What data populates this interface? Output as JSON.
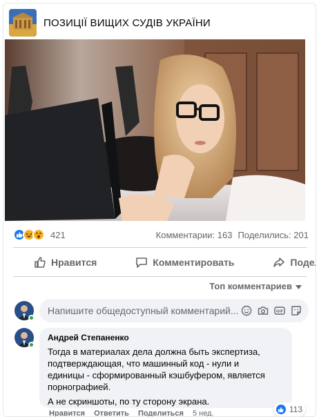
{
  "page": {
    "title": "ПОЗИЦІЇ ВИЩИХ СУДІВ УКРАЇНИ",
    "avatar_icon": "page-logo-icon"
  },
  "post": {
    "photo_icon": "post-photo"
  },
  "stats": {
    "reactions": [
      "like",
      "haha",
      "wow"
    ],
    "reaction_count": "421",
    "comments": "Комментарии: 163",
    "shares": "Поделились: 201"
  },
  "actions": {
    "like": "Нравится",
    "comment": "Комментировать",
    "share": "Поделиться"
  },
  "sort": {
    "label": "Топ комментариев"
  },
  "composer": {
    "placeholder": "Напишите общедоступный комментарий...",
    "icons": [
      "emoji-icon",
      "camera-icon",
      "gif-icon",
      "sticker-icon"
    ]
  },
  "comment": {
    "author": "Андрей Степаненко",
    "lines": [
      "Тогда в материалах дела должна быть экспертиза,",
      "подтверждающая, что машинный код - нули и",
      "единицы - сформированный кэшбуфером, является",
      "порнографией.",
      "А не скриншоты, по ту сторону экрана."
    ],
    "reaction_count": "113",
    "like_label": "Нравится",
    "reply_label": "Ответить",
    "share_label": "Поделиться",
    "time": "5 нед."
  },
  "colors": {
    "like_blue": "#1877f2",
    "haha_yellow": "#f7b125",
    "online_green": "#31a24c",
    "secondary_text": "#65676b",
    "bubble_bg": "#f0f2f5"
  }
}
